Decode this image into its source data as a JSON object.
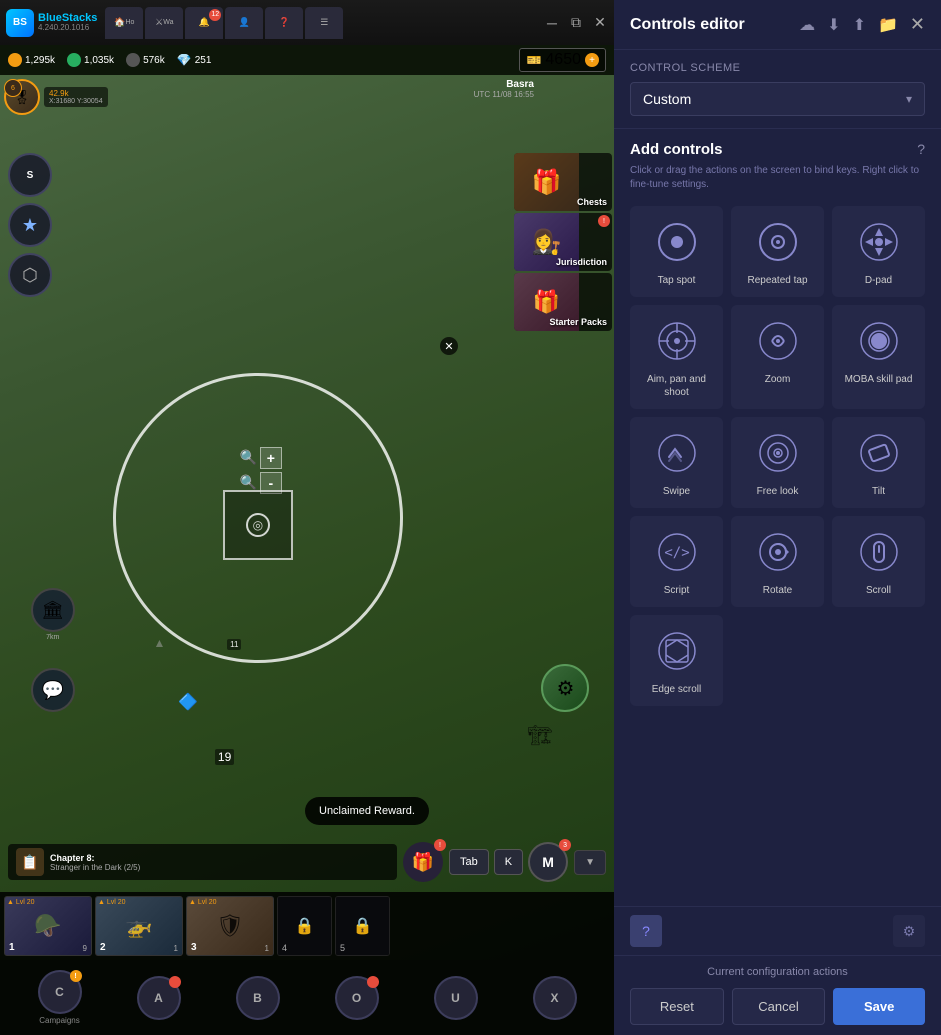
{
  "app": {
    "name": "BlueStacks",
    "version": "4.240.20.1016"
  },
  "tabs": [
    {
      "label": "Ho",
      "active": false
    },
    {
      "label": "Wa",
      "active": false
    },
    {
      "badge": "12"
    }
  ],
  "resources": {
    "gold": "1,295k",
    "food": "1,035k",
    "oil": "576k",
    "gems": "251",
    "special": "4650"
  },
  "player": {
    "level": "6",
    "alliance": "42.9k",
    "coords": "X:31680 Y:30054",
    "location": "Basra",
    "time": "UTC 11/08 16:55"
  },
  "notifications": [
    {
      "label": "Chests",
      "hasBadge": false
    },
    {
      "label": "Jurisdiction",
      "hasBadge": true
    },
    {
      "label": "Starter Packs",
      "hasBadge": false
    }
  ],
  "map": {
    "circle_label": "11",
    "troop_count": "19"
  },
  "quest": {
    "title": "Chapter 8:",
    "subtitle": "Stranger in the Dark (2/5)"
  },
  "bottom_nav": [
    {
      "key": "C",
      "label": "Campaigns",
      "badge": false
    },
    {
      "key": "A",
      "label": "",
      "badge": true
    },
    {
      "key": "B",
      "label": "",
      "badge": false
    },
    {
      "key": "O",
      "label": "",
      "badge": false
    },
    {
      "key": "U",
      "label": "",
      "badge": false
    },
    {
      "key": "X",
      "label": "",
      "badge": false
    }
  ],
  "units": [
    {
      "num": "1",
      "level": "Lvl 20"
    },
    {
      "num": "2",
      "level": "Lvl 20"
    },
    {
      "num": "3",
      "level": "Lvl 20"
    },
    {
      "num": "4",
      "level": ""
    },
    {
      "num": "5",
      "level": ""
    }
  ],
  "controls_editor": {
    "title": "Controls editor",
    "control_scheme_label": "Control scheme",
    "scheme_selected": "Custom",
    "add_controls_title": "Add controls",
    "add_controls_desc": "Click or drag the actions on the screen to bind keys. Right click to fine-tune settings.",
    "controls": [
      {
        "name": "Tap spot",
        "icon": "tap"
      },
      {
        "name": "Repeated tap",
        "icon": "repeated-tap"
      },
      {
        "name": "D-pad",
        "icon": "dpad"
      },
      {
        "name": "Aim, pan and shoot",
        "icon": "aim"
      },
      {
        "name": "Zoom",
        "icon": "zoom"
      },
      {
        "name": "MOBA skill pad",
        "icon": "moba"
      },
      {
        "name": "Swipe",
        "icon": "swipe"
      },
      {
        "name": "Free look",
        "icon": "freelook"
      },
      {
        "name": "Tilt",
        "icon": "tilt"
      },
      {
        "name": "Script",
        "icon": "script"
      },
      {
        "name": "Rotate",
        "icon": "rotate"
      },
      {
        "name": "Scroll",
        "icon": "scroll"
      },
      {
        "name": "Edge scroll",
        "icon": "edgescroll"
      }
    ],
    "footer": {
      "current_config": "Current configuration actions",
      "reset": "Reset",
      "cancel": "Cancel",
      "save": "Save"
    }
  },
  "action_bar": {
    "tab_btn": "Tab",
    "k_btn": "K",
    "m_btn": "M",
    "reward_text": "Unclaimed Reward."
  }
}
